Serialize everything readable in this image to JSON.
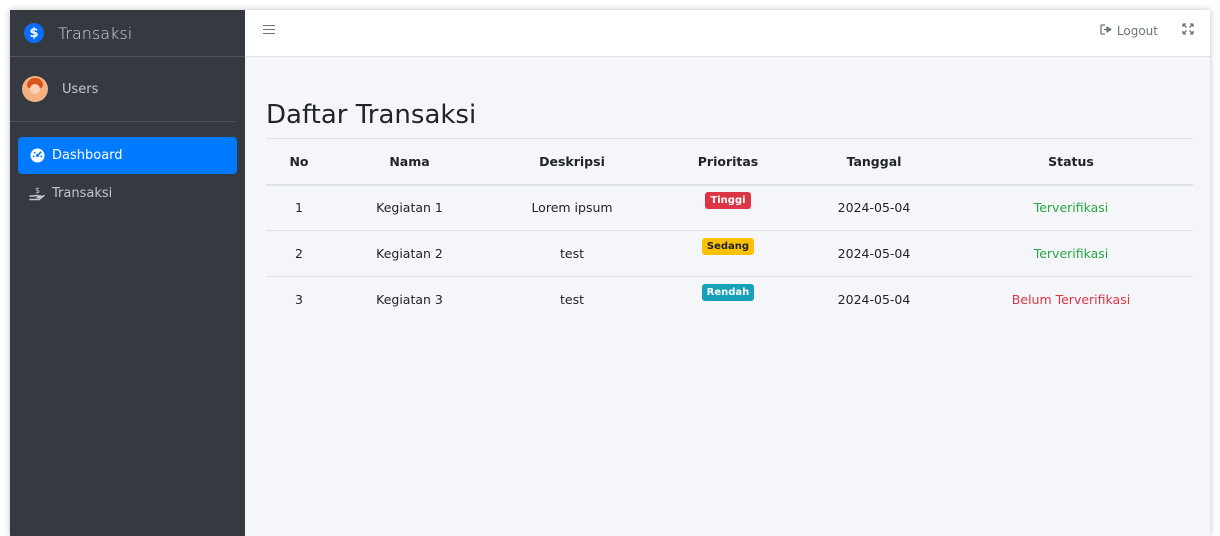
{
  "brand": {
    "logo_symbol": "$",
    "title": "Transaksi"
  },
  "user": {
    "name": "Users",
    "avatar_icon": "user-avatar-icon"
  },
  "sidebar": {
    "items": [
      {
        "label": "Dashboard",
        "icon": "tachometer-icon",
        "active": true
      },
      {
        "label": "Transaksi",
        "icon": "hand-holding-dollar-icon",
        "active": false
      }
    ]
  },
  "topbar": {
    "menu_icon": "hamburger-icon",
    "logout_label": "Logout",
    "logout_icon": "sign-out-icon",
    "expand_icon": "expand-icon"
  },
  "page": {
    "title": "Daftar Transaksi"
  },
  "table": {
    "headers": [
      "No",
      "Nama",
      "Deskripsi",
      "Prioritas",
      "Tanggal",
      "Status"
    ],
    "rows": [
      {
        "no": "1",
        "nama": "Kegiatan 1",
        "deskripsi": "Lorem ipsum",
        "prioritas": "Tinggi",
        "tanggal": "2024-05-04",
        "status": "Terverifikasi"
      },
      {
        "no": "2",
        "nama": "Kegiatan 2",
        "deskripsi": "test",
        "prioritas": "Sedang",
        "tanggal": "2024-05-04",
        "status": "Terverifikasi"
      },
      {
        "no": "3",
        "nama": "Kegiatan 3",
        "deskripsi": "test",
        "prioritas": "Rendah",
        "tanggal": "2024-05-04",
        "status": "Belum Terverifikasi"
      }
    ]
  },
  "colors": {
    "sidebar_bg": "#343a40",
    "active": "#007bff",
    "tinggi": "#dc3545",
    "sedang": "#ffc107",
    "rendah": "#17a2b8",
    "verified": "#28a745",
    "unverified": "#dc3545"
  }
}
